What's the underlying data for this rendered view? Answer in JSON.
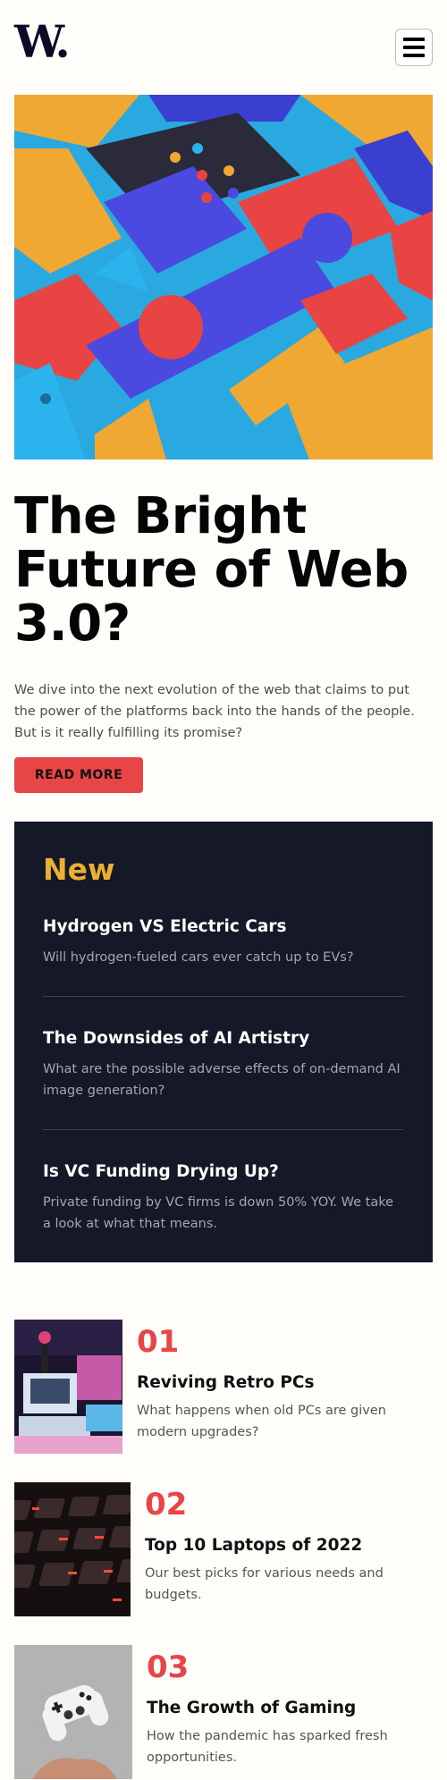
{
  "header": {
    "logo": "W."
  },
  "hero": {
    "title": "The Bright Future of Web 3.0?",
    "description": "We dive into the next evolution of the web that claims to put the power of the platforms back into the hands of the people. But is it really fulfilling its promise?",
    "cta_label": "READ MORE"
  },
  "new_section": {
    "heading": "New",
    "items": [
      {
        "title": "Hydrogen VS Electric Cars",
        "description": "Will hydrogen-fueled cars ever catch up to EVs?"
      },
      {
        "title": "The Downsides of AI Artistry",
        "description": "What are the possible adverse effects of on-demand AI image generation?"
      },
      {
        "title": "Is VC Funding Drying Up?",
        "description": "Private funding by VC firms is down 50% YOY. We take a look at what that means."
      }
    ]
  },
  "articles": [
    {
      "number": "01",
      "title": "Reviving Retro PCs",
      "description": "What happens when old PCs are given modern upgrades?"
    },
    {
      "number": "02",
      "title": "Top 10 Laptops of 2022",
      "description": "Our best picks for various needs and budgets."
    },
    {
      "number": "03",
      "title": "The Growth of Gaming",
      "description": "How the pandemic has sparked fresh opportunities."
    }
  ]
}
